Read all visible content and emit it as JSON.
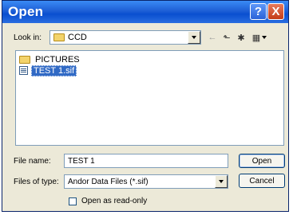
{
  "window": {
    "title": "Open"
  },
  "titlebar_buttons": {
    "help": "?",
    "close": "X"
  },
  "lookin": {
    "label": "Look in:",
    "value": "CCD"
  },
  "toolbar": {
    "back": "←",
    "up_folder": "⬑",
    "new_folder": "✱",
    "view": "▦"
  },
  "files": [
    {
      "name": "PICTURES",
      "type": "folder",
      "selected": false
    },
    {
      "name": "TEST 1.sif",
      "type": "file",
      "selected": true
    }
  ],
  "filename": {
    "label": "File name:",
    "value": "TEST 1"
  },
  "filetype": {
    "label": "Files of type:",
    "value": "Andor Data Files  (*.sif)"
  },
  "buttons": {
    "open": "Open",
    "cancel": "Cancel"
  },
  "readonly": {
    "label": "Open as read-only",
    "checked": false
  }
}
